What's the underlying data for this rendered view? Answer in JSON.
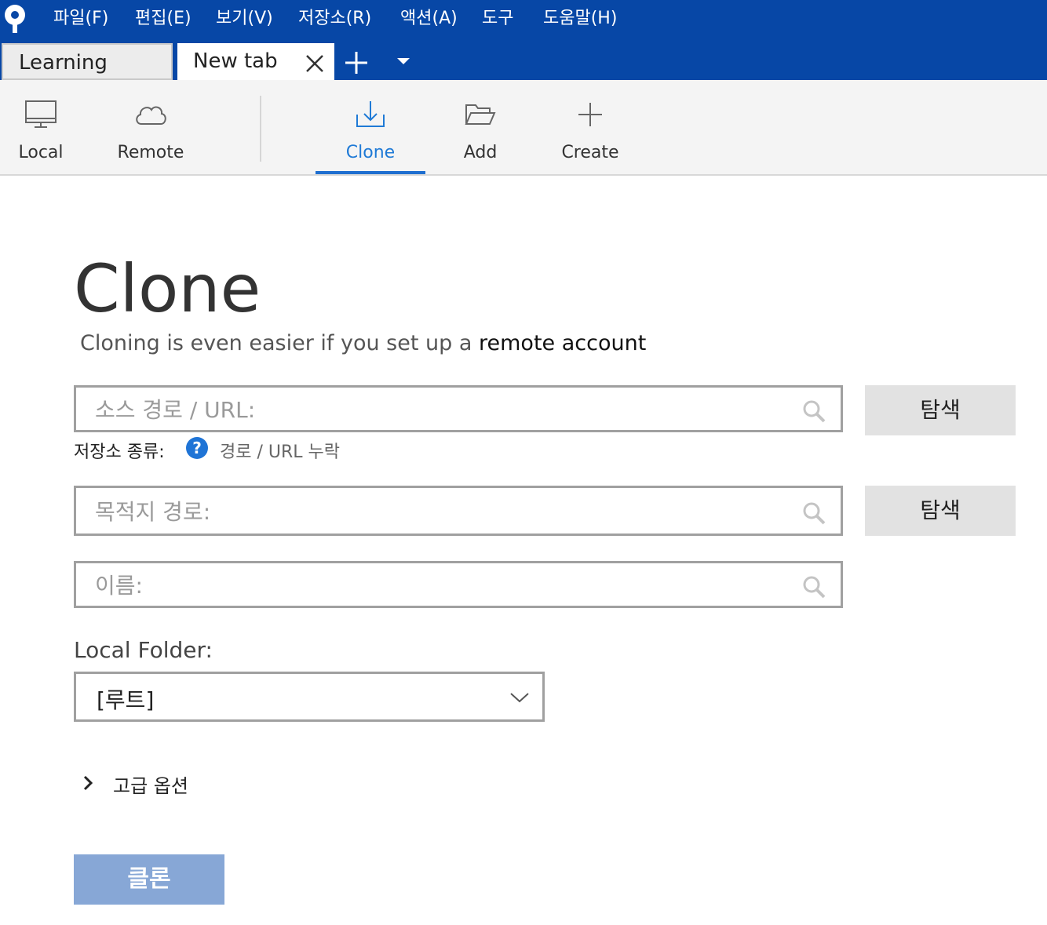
{
  "menu": {
    "items": [
      "파일(F)",
      "편집(E)",
      "보기(V)",
      "저장소(R)",
      "액션(A)",
      "도구",
      "도움말(H)"
    ]
  },
  "tabs": {
    "items": [
      {
        "label": "Learning",
        "active": false
      },
      {
        "label": "New tab",
        "active": true
      }
    ]
  },
  "toolbar": {
    "local": "Local",
    "remote": "Remote",
    "clone": "Clone",
    "add": "Add",
    "create": "Create",
    "active": "Clone"
  },
  "main": {
    "title": "Clone",
    "subtitle_text": "Cloning is even easier if you set up a",
    "subtitle_link": "remote account",
    "source_placeholder": "소스 경로 / URL:",
    "source_value": "",
    "browse_label": "탐색",
    "repo_type_label": "저장소 종류:",
    "repo_type_value": "경로 / URL 누락",
    "destination_placeholder": "목적지 경로:",
    "destination_value": "",
    "name_placeholder": "이름:",
    "name_value": "",
    "local_folder_label": "Local Folder:",
    "local_folder_value": "[루트]",
    "advanced_label": "고급 옵션",
    "clone_button": "클론"
  },
  "colors": {
    "menubar": "#0747a6",
    "accent": "#1f7ad6",
    "clone_button_disabled": "#87a7d6",
    "browse_button": "#e2e2e2"
  }
}
